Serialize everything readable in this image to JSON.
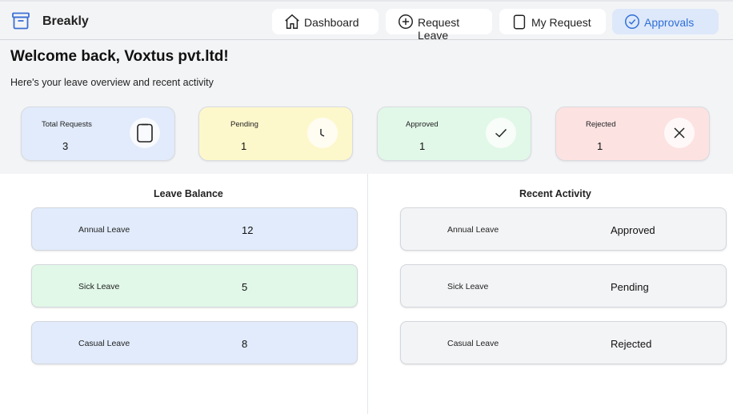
{
  "app": {
    "name": "Breakly",
    "icon": "archive-box-icon"
  },
  "nav": [
    {
      "label": "Dashboard",
      "icon": "home-icon"
    },
    {
      "label": "Request Leave",
      "icon": "plus-circle-icon"
    },
    {
      "label": "My Request",
      "icon": "clipboard-icon"
    },
    {
      "label": "Approvals",
      "icon": "check-circle-icon",
      "active": true
    }
  ],
  "welcome": {
    "title": "Welcome back, Voxtus pvt.ltd!",
    "subtitle": "Here's your leave overview and recent activity"
  },
  "stats": [
    {
      "label": "Total Requests",
      "value": "3",
      "icon": "clipboard-icon",
      "color": "#e1ebfb"
    },
    {
      "label": "Pending",
      "value": "1",
      "icon": "clock-icon",
      "color": "#fdf8cc"
    },
    {
      "label": "Approved",
      "value": "1",
      "icon": "check-icon",
      "color": "#e1f8e8"
    },
    {
      "label": "Rejected",
      "value": "1",
      "icon": "x-icon",
      "color": "#fde2e2"
    }
  ],
  "leave_balance": {
    "title": "Leave Balance",
    "items": [
      {
        "label": "Annual Leave",
        "value": "12",
        "color": "#e1ebfb"
      },
      {
        "label": "Sick Leave",
        "value": "5",
        "color": "#e1f8e8"
      },
      {
        "label": "Casual Leave",
        "value": "8",
        "color": "#e1ebfb"
      }
    ]
  },
  "recent_activity": {
    "title": "Recent Activity",
    "items": [
      {
        "label": "Annual Leave",
        "status": "Approved"
      },
      {
        "label": "Sick Leave",
        "status": "Pending"
      },
      {
        "label": "Casual Leave",
        "status": "Rejected"
      }
    ]
  }
}
